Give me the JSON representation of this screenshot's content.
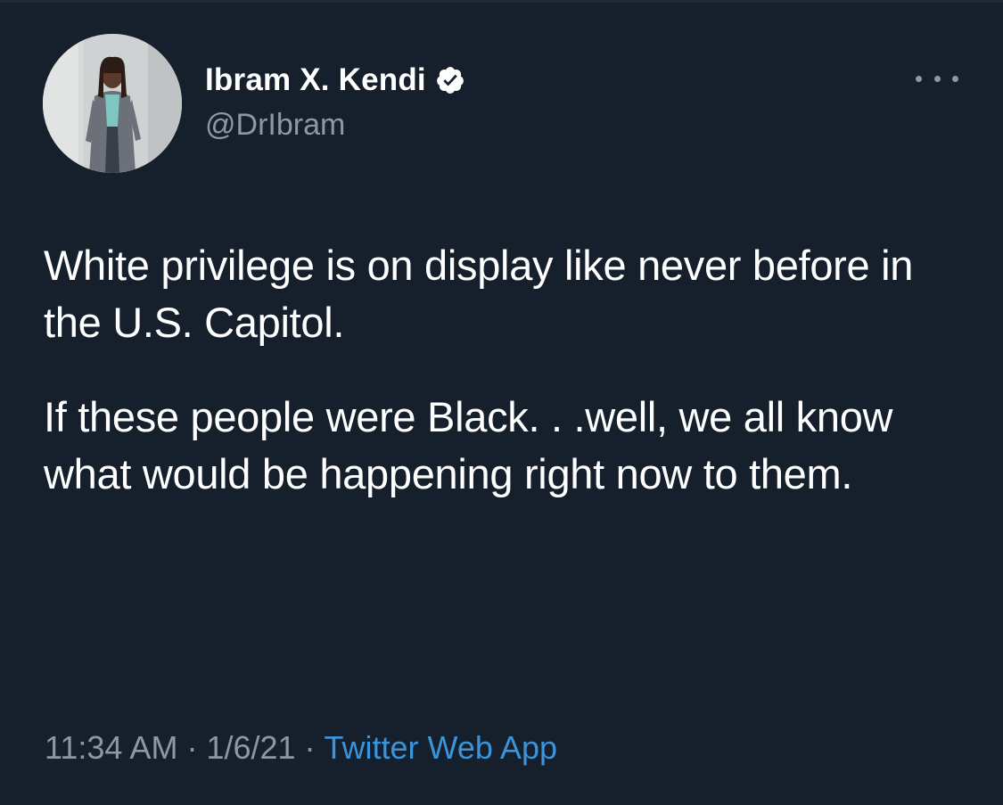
{
  "tweet": {
    "author": {
      "display_name": "Ibram X. Kendi",
      "handle": "@DrIbram",
      "verified": true,
      "avatar_icon": "profile-photo"
    },
    "text": [
      "White privilege is on display like never before in the U.S. Capitol.",
      "If these people were Black. . .well, we all know what would be happening right now to them."
    ],
    "time": "11:34 AM",
    "date": "1/6/21",
    "separator": "·",
    "source": "Twitter Web App",
    "more_icon": "ellipsis-icon"
  },
  "colors": {
    "background": "#16202c",
    "primary_text": "#ffffff",
    "secondary_text": "#8b98a5",
    "link": "#3b94d9",
    "verified_badge": "#ffffff"
  }
}
